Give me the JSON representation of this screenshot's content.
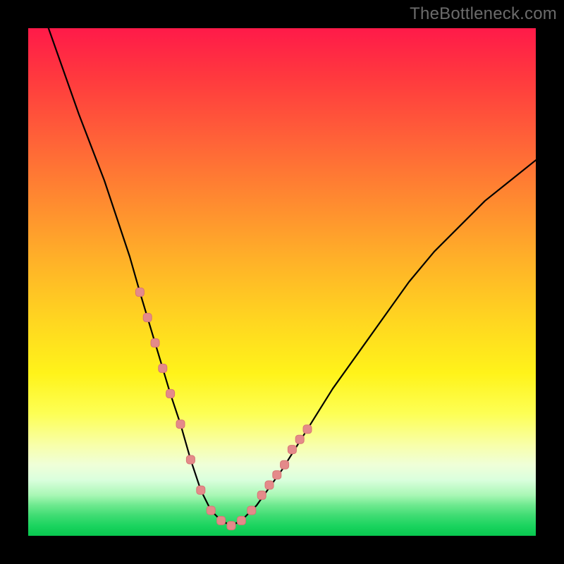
{
  "watermark": "TheBottleneck.com",
  "colors": {
    "curve": "#000000",
    "marker_fill": "#e48a8a",
    "marker_stroke": "#d87575"
  },
  "chart_data": {
    "type": "line",
    "title": "",
    "xlabel": "",
    "ylabel": "",
    "xlim": [
      0,
      100
    ],
    "ylim": [
      0,
      100
    ],
    "grid": false,
    "legend": false,
    "note": "No axis ticks or numeric labels are rendered; values below are read off positionally (0–100 scale, origin at bottom-left).",
    "series": [
      {
        "name": "curve",
        "x": [
          4,
          10,
          15,
          20,
          22,
          25,
          28,
          30,
          32,
          34,
          36,
          38,
          40,
          42,
          45,
          50,
          55,
          60,
          65,
          70,
          75,
          80,
          85,
          90,
          95,
          100
        ],
        "y": [
          100,
          83,
          70,
          55,
          48,
          38,
          28,
          22,
          15,
          9,
          5,
          3,
          2,
          3,
          6,
          13,
          21,
          29,
          36,
          43,
          50,
          56,
          61,
          66,
          70,
          74
        ]
      }
    ],
    "markers": {
      "name": "highlight-dots",
      "x": [
        22,
        23.5,
        25,
        26.5,
        28,
        30,
        32,
        34,
        36,
        38,
        40,
        42,
        44,
        46,
        47.5,
        49,
        50.5,
        52,
        53.5,
        55
      ],
      "y": [
        48,
        43,
        38,
        33,
        28,
        22,
        15,
        9,
        5,
        3,
        2,
        3,
        5,
        8,
        10,
        12,
        14,
        17,
        19,
        21
      ]
    }
  }
}
